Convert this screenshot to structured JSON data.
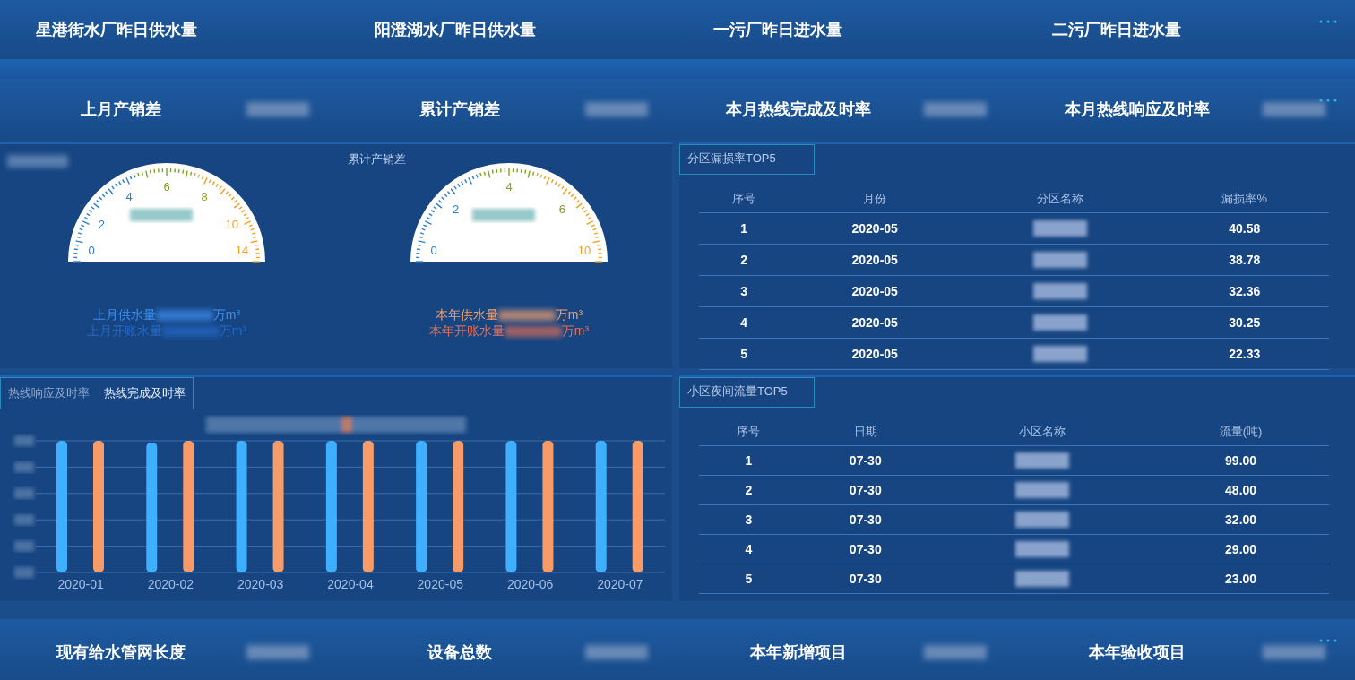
{
  "top_stats": [
    {
      "label": "星港街水厂昨日供水量"
    },
    {
      "label": "阳澄湖水厂昨日供水量"
    },
    {
      "label": "一污厂昨日进水量"
    },
    {
      "label": "二污厂昨日进水量"
    }
  ],
  "second_stats": [
    {
      "label": "上月产销差"
    },
    {
      "label": "累计产销差"
    },
    {
      "label": "本月热线完成及时率"
    },
    {
      "label": "本月热线响应及时率"
    }
  ],
  "gauge_panel": {
    "title": "累计产销差",
    "gauges": [
      {
        "ticks": [
          {
            "label": "0",
            "kind": "low"
          },
          {
            "label": "2",
            "kind": "low"
          },
          {
            "label": "4",
            "kind": "low"
          },
          {
            "label": "6",
            "kind": "mid"
          },
          {
            "label": "8",
            "kind": "mid"
          },
          {
            "label": "10",
            "kind": "high"
          },
          {
            "label": "14",
            "kind": "high"
          }
        ],
        "lines": [
          {
            "label": "上月供水量",
            "unit": "万m³",
            "kind": "primary",
            "color": "#3d8ff0"
          },
          {
            "label": "上月开账水量",
            "unit": "万m³",
            "kind": "secondary",
            "color": "#2569c8"
          }
        ]
      },
      {
        "ticks": [
          {
            "label": "0",
            "kind": "low"
          },
          {
            "label": "2",
            "kind": "low"
          },
          {
            "label": "4",
            "kind": "mid"
          },
          {
            "label": "6",
            "kind": "mid"
          },
          {
            "label": "10",
            "kind": "high"
          }
        ],
        "lines": [
          {
            "label": "本年供水量",
            "unit": "万m³",
            "kind": "primary",
            "color": "#f3a070"
          },
          {
            "label": "本年开账水量",
            "unit": "万m³",
            "kind": "secondary",
            "color": "#e0705a"
          }
        ]
      }
    ]
  },
  "leak_table": {
    "title": "分区漏损率TOP5",
    "columns": [
      "序号",
      "月份",
      "分区名称",
      "漏损率%"
    ],
    "rows": [
      {
        "no": "1",
        "period": "2020-05",
        "value": "40.58"
      },
      {
        "no": "2",
        "period": "2020-05",
        "value": "38.78"
      },
      {
        "no": "3",
        "period": "2020-05",
        "value": "32.36"
      },
      {
        "no": "4",
        "period": "2020-05",
        "value": "30.25"
      },
      {
        "no": "5",
        "period": "2020-05",
        "value": "22.33"
      }
    ]
  },
  "hotline_panel": {
    "tabs": [
      {
        "label": "热线响应及时率",
        "selected": false
      },
      {
        "label": "热线完成及时率",
        "selected": true
      }
    ],
    "x_labels": [
      "2020-01",
      "2020-02",
      "2020-03",
      "2020-04",
      "2020-05",
      "2020-06",
      "2020-07"
    ]
  },
  "night_flow_table": {
    "title": "小区夜间流量TOP5",
    "columns": [
      "序号",
      "日期",
      "小区名称",
      "流量(吨)"
    ],
    "rows": [
      {
        "no": "1",
        "period": "07-30",
        "value": "99.00"
      },
      {
        "no": "2",
        "period": "07-30",
        "value": "48.00"
      },
      {
        "no": "3",
        "period": "07-30",
        "value": "32.00"
      },
      {
        "no": "4",
        "period": "07-30",
        "value": "29.00"
      },
      {
        "no": "5",
        "period": "07-30",
        "value": "23.00"
      }
    ]
  },
  "bottom_stats": [
    {
      "label": "现有给水管网长度"
    },
    {
      "label": "设备总数"
    },
    {
      "label": "本年新增项目"
    },
    {
      "label": "本年验收项目"
    }
  ]
}
